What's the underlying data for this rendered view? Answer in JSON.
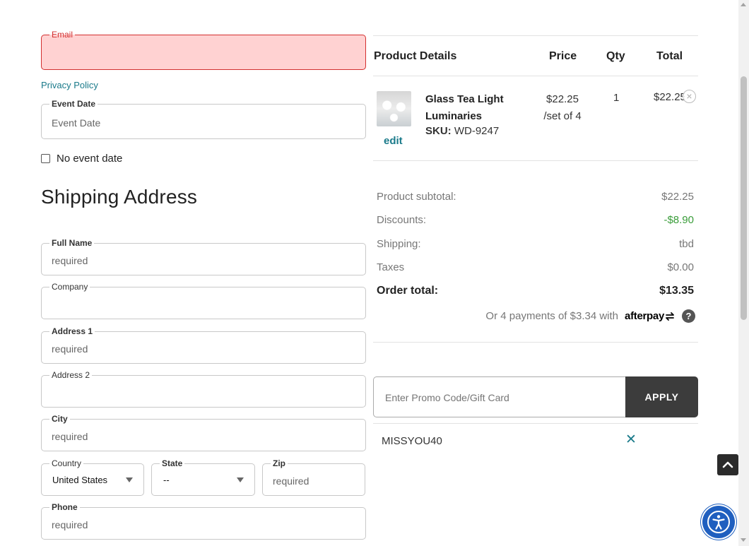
{
  "form": {
    "email": {
      "label": "Email",
      "value": ""
    },
    "privacy_link": "Privacy Policy",
    "event_date": {
      "label": "Event Date",
      "placeholder": "Event Date"
    },
    "no_event_date_label": "No event date",
    "shipping_title": "Shipping Address",
    "full_name": {
      "label": "Full Name",
      "placeholder": "required"
    },
    "company": {
      "label": "Company",
      "placeholder": ""
    },
    "address1": {
      "label": "Address 1",
      "placeholder": "required"
    },
    "address2": {
      "label": "Address 2",
      "placeholder": ""
    },
    "city": {
      "label": "City",
      "placeholder": "required"
    },
    "country": {
      "label": "Country",
      "value": "United States"
    },
    "state": {
      "label": "State",
      "value": "--"
    },
    "zip": {
      "label": "Zip",
      "placeholder": "required"
    },
    "phone": {
      "label": "Phone",
      "placeholder": "required"
    }
  },
  "cart": {
    "headers": {
      "product": "Product Details",
      "price": "Price",
      "qty": "Qty",
      "total": "Total"
    },
    "item": {
      "name_line1": "Glass Tea Light",
      "name_line2": "Luminaries",
      "sku_label": "SKU:",
      "sku": "WD-9247",
      "edit_label": "edit",
      "price": "$22.25",
      "price_unit": "/set of 4",
      "qty": "1",
      "total": "$22.25"
    }
  },
  "summary": {
    "subtotal_label": "Product subtotal:",
    "subtotal": "$22.25",
    "discounts_label": "Discounts:",
    "discounts": "-$8.90",
    "shipping_label": "Shipping:",
    "shipping": "tbd",
    "taxes_label": "Taxes",
    "taxes": "$0.00",
    "order_total_label": "Order total:",
    "order_total": "$13.35",
    "afterpay_text": "Or 4 payments of $3.34 with",
    "afterpay_brand": "afterpay"
  },
  "promo": {
    "placeholder": "Enter Promo Code/Gift Card",
    "apply_label": "APPLY",
    "applied_code": "MISSYOU40"
  },
  "colors": {
    "error": "#d32f2f",
    "error_bg": "#ffd2d2",
    "link": "#1a7a8a",
    "discount": "#3a9d3a",
    "apply_button": "#3c3c3c",
    "accessibility": "#1f5fbf"
  }
}
